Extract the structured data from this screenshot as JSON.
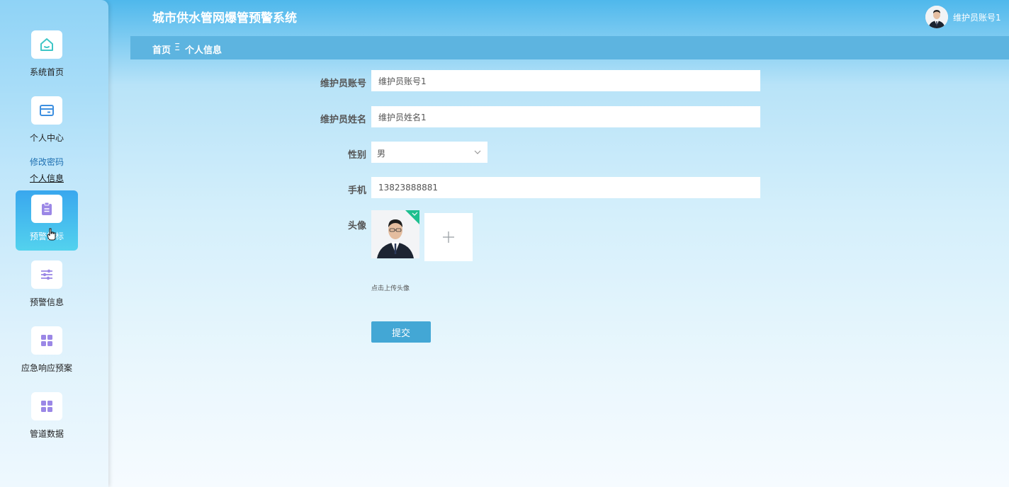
{
  "header": {
    "title": "城市供水管网爆管预警系统",
    "user_name": "维护员账号1"
  },
  "sidebar": {
    "items": [
      {
        "label": "系统首页",
        "icon": "home-icon",
        "color": "#3fc6c6"
      },
      {
        "label": "个人中心",
        "icon": "card-icon",
        "color": "#3d8fe0"
      },
      {
        "label": "预警指标",
        "icon": "clipboard-icon",
        "color": "#9b87e6"
      },
      {
        "label": "预警信息",
        "icon": "sliders-icon",
        "color": "#9b87e6"
      },
      {
        "label": "应急响应预案",
        "icon": "grid-icon",
        "color": "#9b87e6"
      },
      {
        "label": "管道数据",
        "icon": "grid-icon",
        "color": "#9b87e6"
      }
    ],
    "sub_items": [
      {
        "label": "修改密码"
      },
      {
        "label": "个人信息"
      }
    ],
    "active_index": 2
  },
  "breadcrumb": {
    "home": "首页",
    "separator": "Ξ",
    "current": "个人信息"
  },
  "form": {
    "account_label": "维护员账号",
    "account_value": "维护员账号1",
    "name_label": "维护员姓名",
    "name_value": "维护员姓名1",
    "gender_label": "性别",
    "gender_value": "男",
    "phone_label": "手机",
    "phone_value": "13823888881",
    "avatar_label": "头像",
    "upload_hint": "点击上传头像",
    "submit_label": "提交"
  },
  "colors": {
    "breadcrumb_bg": "#5db4e0",
    "submit_bg": "#43a7d5",
    "active_menu_from": "#39a7ee",
    "active_menu_to": "#53d2ee",
    "upload_badge": "#1fbf8f"
  }
}
